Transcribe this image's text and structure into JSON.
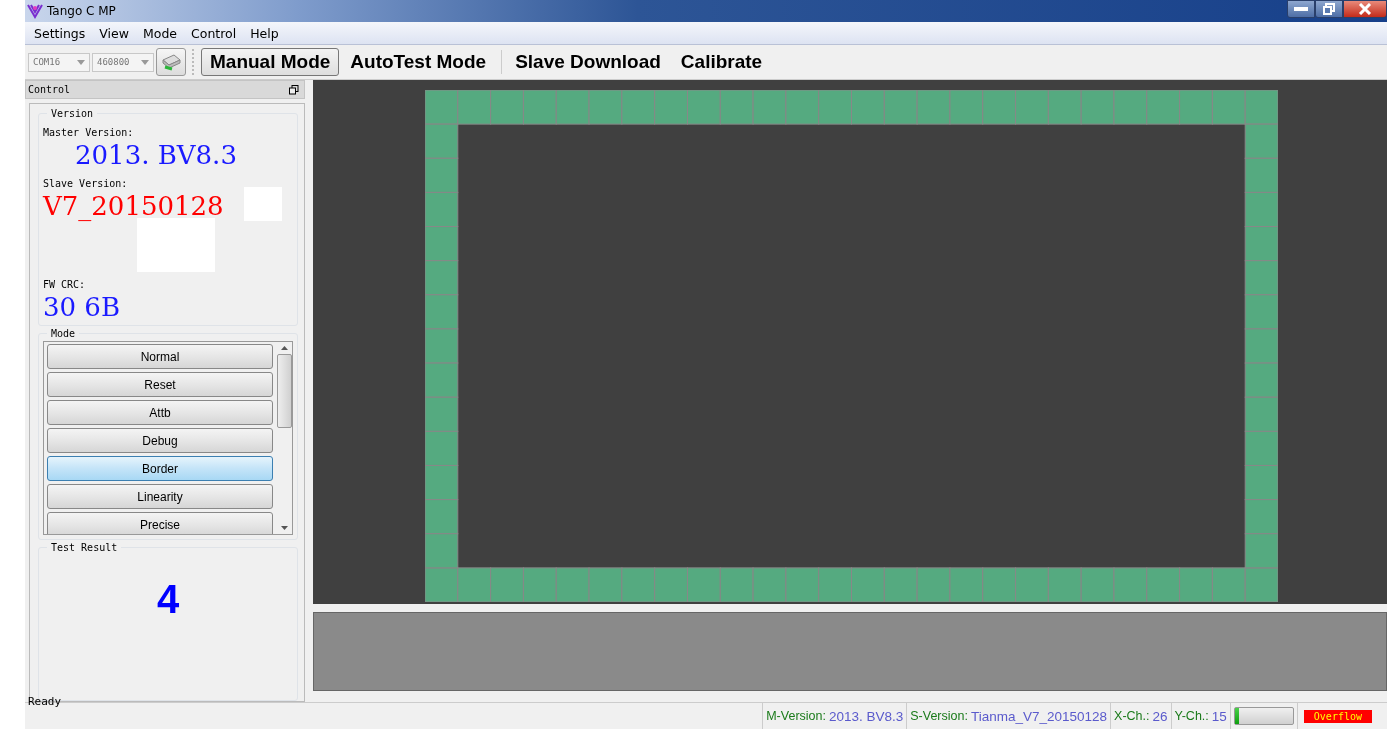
{
  "window": {
    "title": "Tango C MP"
  },
  "menu": [
    "Settings",
    "View",
    "Mode",
    "Control",
    "Help"
  ],
  "toolbar": {
    "port": "COM16",
    "baud": "460800",
    "modes": [
      {
        "label": "Manual Mode",
        "selected": true
      },
      {
        "label": "AutoTest Mode",
        "selected": false
      },
      {
        "label": "Slave Download",
        "selected": false
      },
      {
        "label": "Calibrate",
        "selected": false
      }
    ]
  },
  "control_panel": {
    "title": "Control",
    "version": {
      "title": "Version",
      "master_label": "Master Version:",
      "master_value": "2013. BV8.3",
      "slave_label": "Slave Version:",
      "slave_value": "V7_20150128",
      "crc_label": "FW CRC:",
      "crc_value": "30 6B"
    },
    "mode": {
      "title": "Mode",
      "items": [
        {
          "label": "Normal",
          "selected": false
        },
        {
          "label": "Reset",
          "selected": false
        },
        {
          "label": "Attb",
          "selected": false
        },
        {
          "label": "Debug",
          "selected": false
        },
        {
          "label": "Border",
          "selected": true
        },
        {
          "label": "Linearity",
          "selected": false
        },
        {
          "label": "Precise",
          "selected": false
        }
      ]
    },
    "test_result": {
      "title": "Test Result",
      "value": "4"
    }
  },
  "status_bar": {
    "message": "Ready",
    "m_version_label": "M-Version:",
    "m_version": "2013. BV8.3",
    "s_version_label": "S-Version:",
    "s_version": "Tianma_V7_20150128",
    "x_label": "X-Ch.:",
    "x_value": "26",
    "y_label": "Y-Ch.:",
    "y_value": "15",
    "progress": {
      "level": 0.08
    },
    "alert": "Overflow"
  }
}
